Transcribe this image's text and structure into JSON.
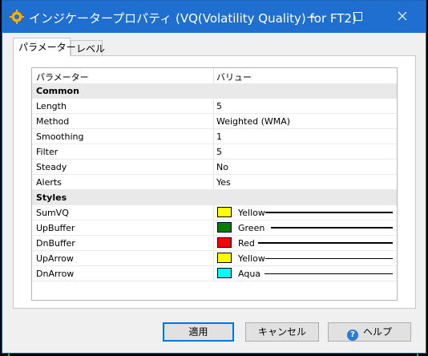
{
  "window": {
    "title": "インジケータープロパティ (VQ(Volatility Quality) for FT2)"
  },
  "tabs": [
    {
      "label": "パラメーター",
      "active": true
    },
    {
      "label": "レベル",
      "active": false
    }
  ],
  "grid": {
    "header": {
      "name": "パラメーター",
      "value": "バリュー"
    },
    "groups": [
      {
        "label": "Common",
        "rows": [
          {
            "name": "Length",
            "value": "5"
          },
          {
            "name": "Method",
            "value": "Weighted (WMA)"
          },
          {
            "name": "Smoothing",
            "value": "1"
          },
          {
            "name": "Filter",
            "value": "5"
          },
          {
            "name": "Steady",
            "value": "No"
          },
          {
            "name": "Alerts",
            "value": "Yes"
          }
        ]
      },
      {
        "label": "Styles",
        "rows": [
          {
            "name": "SumVQ",
            "color": "#ffff00",
            "color_name": "Yellow"
          },
          {
            "name": "UpBuffer",
            "color": "#008000",
            "color_name": "Green"
          },
          {
            "name": "DnBuffer",
            "color": "#ff0000",
            "color_name": "Red"
          },
          {
            "name": "UpArrow",
            "color": "#ffff00",
            "color_name": "Yellow"
          },
          {
            "name": "DnArrow",
            "color": "#00ffff",
            "color_name": "Aqua"
          }
        ]
      }
    ]
  },
  "buttons": {
    "ok": "適用",
    "cancel": "キャンセル",
    "help": "ヘルプ"
  }
}
